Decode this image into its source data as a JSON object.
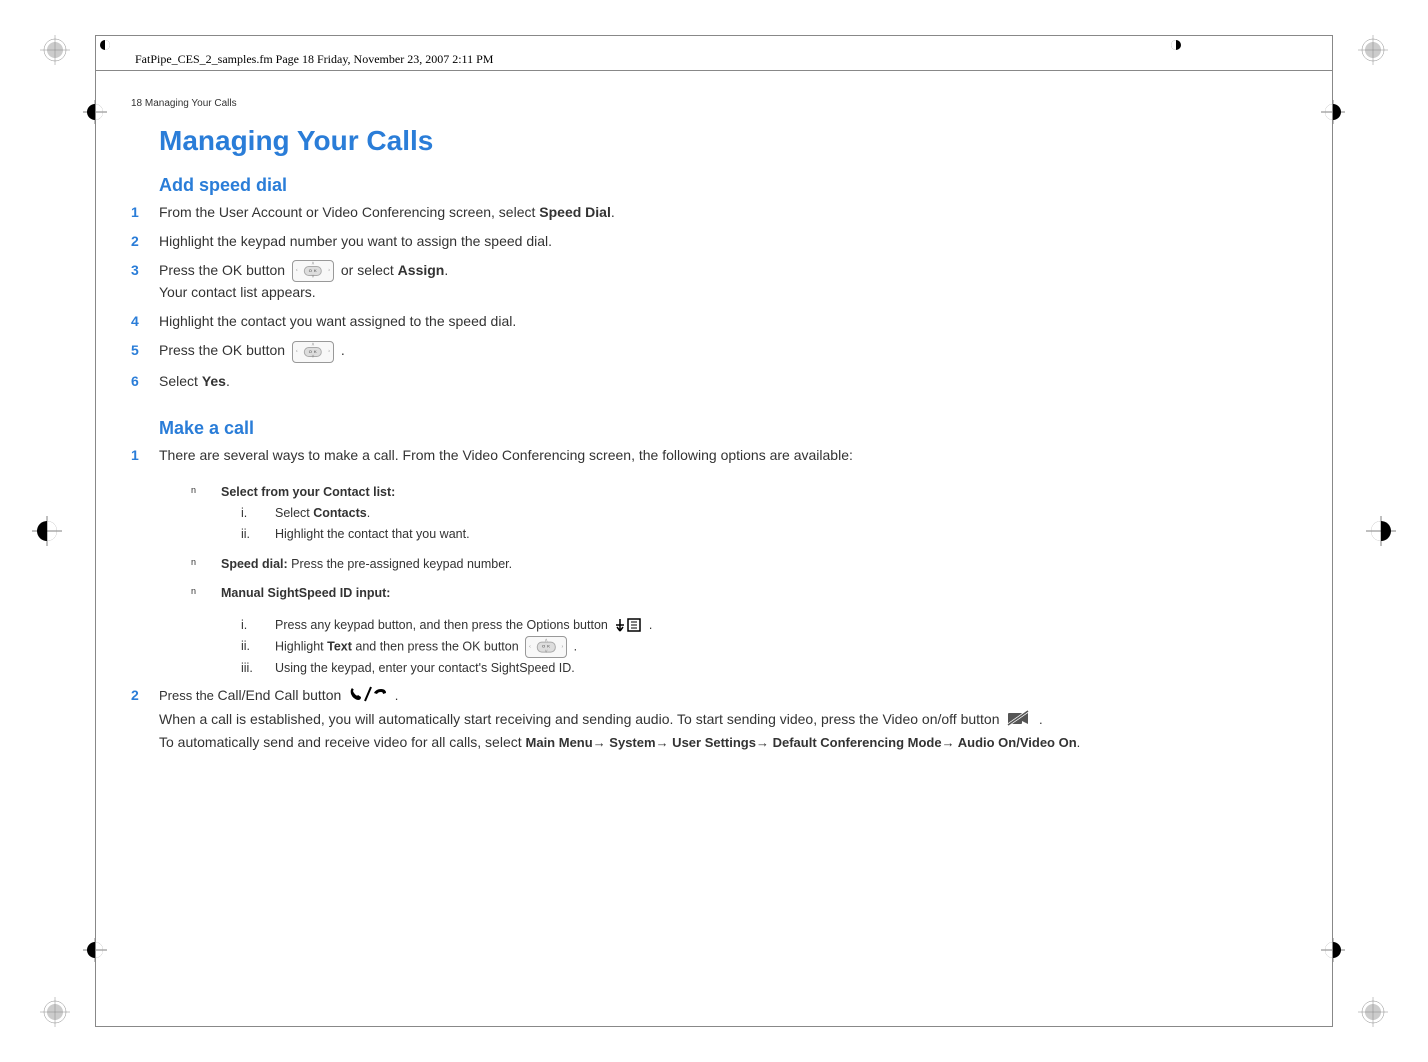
{
  "crop_header": "FatPipe_CES_2_samples.fm  Page 18  Friday, November 23, 2007  2:11 PM",
  "running_header": "18  Managing Your Calls",
  "title": "Managing Your Calls",
  "sections": {
    "add_speed_dial": {
      "heading": "Add speed dial",
      "steps": [
        {
          "n": "1",
          "pre": "From the User Account or Video Conferencing screen, select ",
          "bold": "Speed Dial",
          "post": "."
        },
        {
          "n": "2",
          "text": "Highlight the keypad number you want to assign the speed dial."
        },
        {
          "n": "3",
          "pre": "Press the OK button ",
          "mid": "  or select ",
          "bold": "Assign",
          "post": ".",
          "line2": "Your contact list appears."
        },
        {
          "n": "4",
          "text": "Highlight the contact you want assigned to the speed dial."
        },
        {
          "n": "5",
          "pre": "Press the OK button ",
          "post": " ."
        },
        {
          "n": "6",
          "pre": "Select ",
          "bold": "Yes",
          "post": "."
        }
      ]
    },
    "make_call": {
      "heading": "Make a call",
      "step1_n": "1",
      "step1": "There are several ways to make a call. From the Video Conferencing screen, the following options are available:",
      "bullet1_label": "Select from your Contact list:",
      "b1_i_mark": "i.",
      "b1_i_pre": "Select ",
      "b1_i_bold": "Contacts",
      "b1_i_post": ".",
      "b1_ii_mark": "ii.",
      "b1_ii": "Highlight the contact that you want.",
      "bullet2_label": "Speed dial:",
      "bullet2_rest": " Press the pre-assigned keypad number.",
      "bullet3_label": "Manual SightSpeed ID input:",
      "b3_i_mark": "i.",
      "b3_i_pre": "Press any keypad button, and then press the Options button ",
      "b3_i_post": " .",
      "b3_ii_mark": "ii.",
      "b3_ii_pre": "Highlight ",
      "b3_ii_bold": "Text",
      "b3_ii_mid": " and then press the OK button ",
      "b3_ii_post": " .",
      "b3_iii_mark": "iii.",
      "b3_iii": "Using the keypad, enter your contact's SightSpeed ID.",
      "step2_n": "2",
      "step2_pre": "Press the ",
      "step2_btn": "Call/End Call button ",
      "step2_post": " .",
      "step2_l2a": "When a call is established, you will automatically start receiving and sending audio. To start sending video, press the Video on/off button ",
      "step2_l2b": " .",
      "step2_l3a": "To automatically send and receive video for all calls, select ",
      "path1": "Main Menu",
      "path2": " System",
      "path3": " User Settings",
      "path4": " Default Conferencing Mode",
      "path5": " Audio On/Video On",
      "arrow": "→",
      "period": "."
    }
  },
  "bullet_char": "n"
}
